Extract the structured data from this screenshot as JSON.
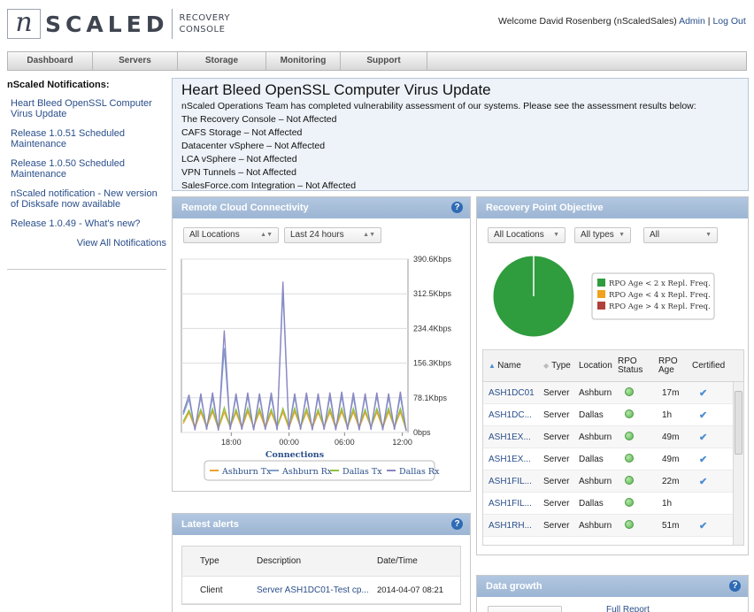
{
  "header": {
    "logo_letter": "n",
    "logo_word": "SCALED",
    "logo_sub1": "RECOVERY",
    "logo_sub2": "CONSOLE",
    "welcome_text": "Welcome David Rosenberg (nScaledSales)",
    "admin_link": "Admin",
    "separator": "|",
    "logout_link": "Log Out"
  },
  "nav": [
    {
      "label": "Dashboard"
    },
    {
      "label": "Servers"
    },
    {
      "label": "Storage"
    },
    {
      "label": "Monitoring"
    },
    {
      "label": "Support"
    }
  ],
  "notifications": {
    "title": "nScaled Notifications:",
    "items": [
      {
        "label": "Heart Bleed OpenSSL Computer Virus Update"
      },
      {
        "label": "Release 1.0.51 Scheduled Maintenance"
      },
      {
        "label": "Release 1.0.50 Scheduled Maintenance"
      },
      {
        "label": "nScaled notification - New version of Disksafe now available"
      },
      {
        "label": "Release 1.0.49 - What's new?"
      }
    ],
    "view_all": "View All Notifications"
  },
  "announcement": {
    "title": "Heart Bleed OpenSSL Computer Virus Update",
    "lines": [
      "nScaled Operations Team has completed vulnerability assessment of our systems. Please see the assessment results below:",
      "The Recovery Console – Not Affected",
      "CAFS Storage – Not Affected",
      "Datacenter vSphere – Not Affected",
      "LCA vSphere – Not Affected",
      "VPN Tunnels – Not Affected",
      "SalesForce.com Integration – Not Affected"
    ]
  },
  "connectivity": {
    "title": "Remote Cloud Connectivity",
    "help": "?",
    "location_select": "All Locations",
    "range_select": "Last 24 hours"
  },
  "chart_data": {
    "type": "line",
    "xlabel": "Connections",
    "ylabel": "",
    "x_ticks": [
      "18:00",
      "00:00",
      "06:00",
      "12:00"
    ],
    "y_ticks": [
      "0bps",
      "78.1Kbps",
      "156.3Kbps",
      "234.4Kbps",
      "312.5Kbps",
      "390.6Kbps"
    ],
    "ylim": [
      0,
      390.6
    ],
    "y_unit": "Kbps",
    "legend_position": "bottom",
    "series": [
      {
        "name": "Ashburn Tx",
        "color": "#f0a030",
        "values": [
          20,
          45,
          10,
          46,
          12,
          47,
          8,
          46,
          12,
          45,
          10,
          47,
          12,
          46,
          10,
          45,
          12,
          46,
          10,
          47,
          12,
          46,
          10,
          45,
          12,
          46,
          10,
          47,
          12,
          46,
          10,
          45,
          12,
          46,
          10,
          47,
          12,
          46,
          5
        ]
      },
      {
        "name": "Ashburn Rx",
        "color": "#7fa0cc",
        "values": [
          40,
          75,
          8,
          80,
          10,
          80,
          6,
          190,
          8,
          80,
          10,
          82,
          6,
          80,
          10,
          80,
          8,
          320,
          8,
          80,
          10,
          82,
          8,
          80,
          10,
          80,
          8,
          82,
          10,
          80,
          8,
          80,
          10,
          82,
          8,
          80,
          10,
          82,
          4
        ]
      },
      {
        "name": "Dallas Tx",
        "color": "#90c040",
        "values": [
          25,
          50,
          14,
          52,
          15,
          54,
          10,
          56,
          12,
          52,
          14,
          55,
          12,
          54,
          14,
          52,
          12,
          54,
          14,
          55,
          12,
          54,
          14,
          52,
          12,
          54,
          14,
          55,
          12,
          54,
          14,
          52,
          12,
          54,
          14,
          55,
          12,
          54,
          6
        ]
      },
      {
        "name": "Dallas Rx",
        "color": "#8a86c4",
        "values": [
          45,
          85,
          5,
          88,
          6,
          90,
          4,
          230,
          6,
          88,
          6,
          90,
          5,
          88,
          6,
          90,
          5,
          340,
          6,
          88,
          6,
          90,
          5,
          88,
          6,
          90,
          5,
          92,
          6,
          90,
          5,
          88,
          6,
          90,
          5,
          88,
          6,
          92,
          3
        ]
      }
    ]
  },
  "rpo": {
    "title": "Recovery Point Objective",
    "help": "?",
    "location_select": "All Locations",
    "type_select": "All types",
    "filter_select": "All",
    "pie": [
      {
        "label": "RPO Age < 2 x Repl. Freq.",
        "value": 100,
        "color": "#2f9c3e"
      },
      {
        "label": "RPO Age < 4 x Repl. Freq.",
        "value": 0,
        "color": "#f0a21e"
      },
      {
        "label": "RPO Age > 4 x Repl. Freq.",
        "value": 0,
        "color": "#b0403c"
      }
    ],
    "columns": [
      "Name",
      "Type",
      "Location",
      "RPO Status",
      "RPO Age",
      "Certified"
    ],
    "rows": [
      {
        "name": "ASH1DC01",
        "type": "Server",
        "location": "Ashburn",
        "age": "17m",
        "certified": "✔"
      },
      {
        "name": "ASH1DC...",
        "type": "Server",
        "location": "Dallas",
        "age": "1h",
        "certified": "✔"
      },
      {
        "name": "ASH1EX...",
        "type": "Server",
        "location": "Ashburn",
        "age": "49m",
        "certified": "✔"
      },
      {
        "name": "ASH1EX...",
        "type": "Server",
        "location": "Dallas",
        "age": "49m",
        "certified": "✔"
      },
      {
        "name": "ASH1FIL...",
        "type": "Server",
        "location": "Ashburn",
        "age": "22m",
        "certified": "✔"
      },
      {
        "name": "ASH1FIL...",
        "type": "Server",
        "location": "Dallas",
        "age": "1h",
        "certified": ""
      },
      {
        "name": "ASH1RH...",
        "type": "Server",
        "location": "Ashburn",
        "age": "51m",
        "certified": "✔"
      }
    ]
  },
  "alerts": {
    "title": "Latest alerts",
    "help": "?",
    "columns": [
      "Type",
      "Description",
      "Date/Time"
    ],
    "rows": [
      {
        "type": "Client",
        "description": "Server ASH1DC01-Test cp...",
        "datetime": "2014-04-07 08:21"
      }
    ]
  },
  "growth": {
    "title": "Data growth",
    "help": "?",
    "full_report": "Full Report"
  }
}
